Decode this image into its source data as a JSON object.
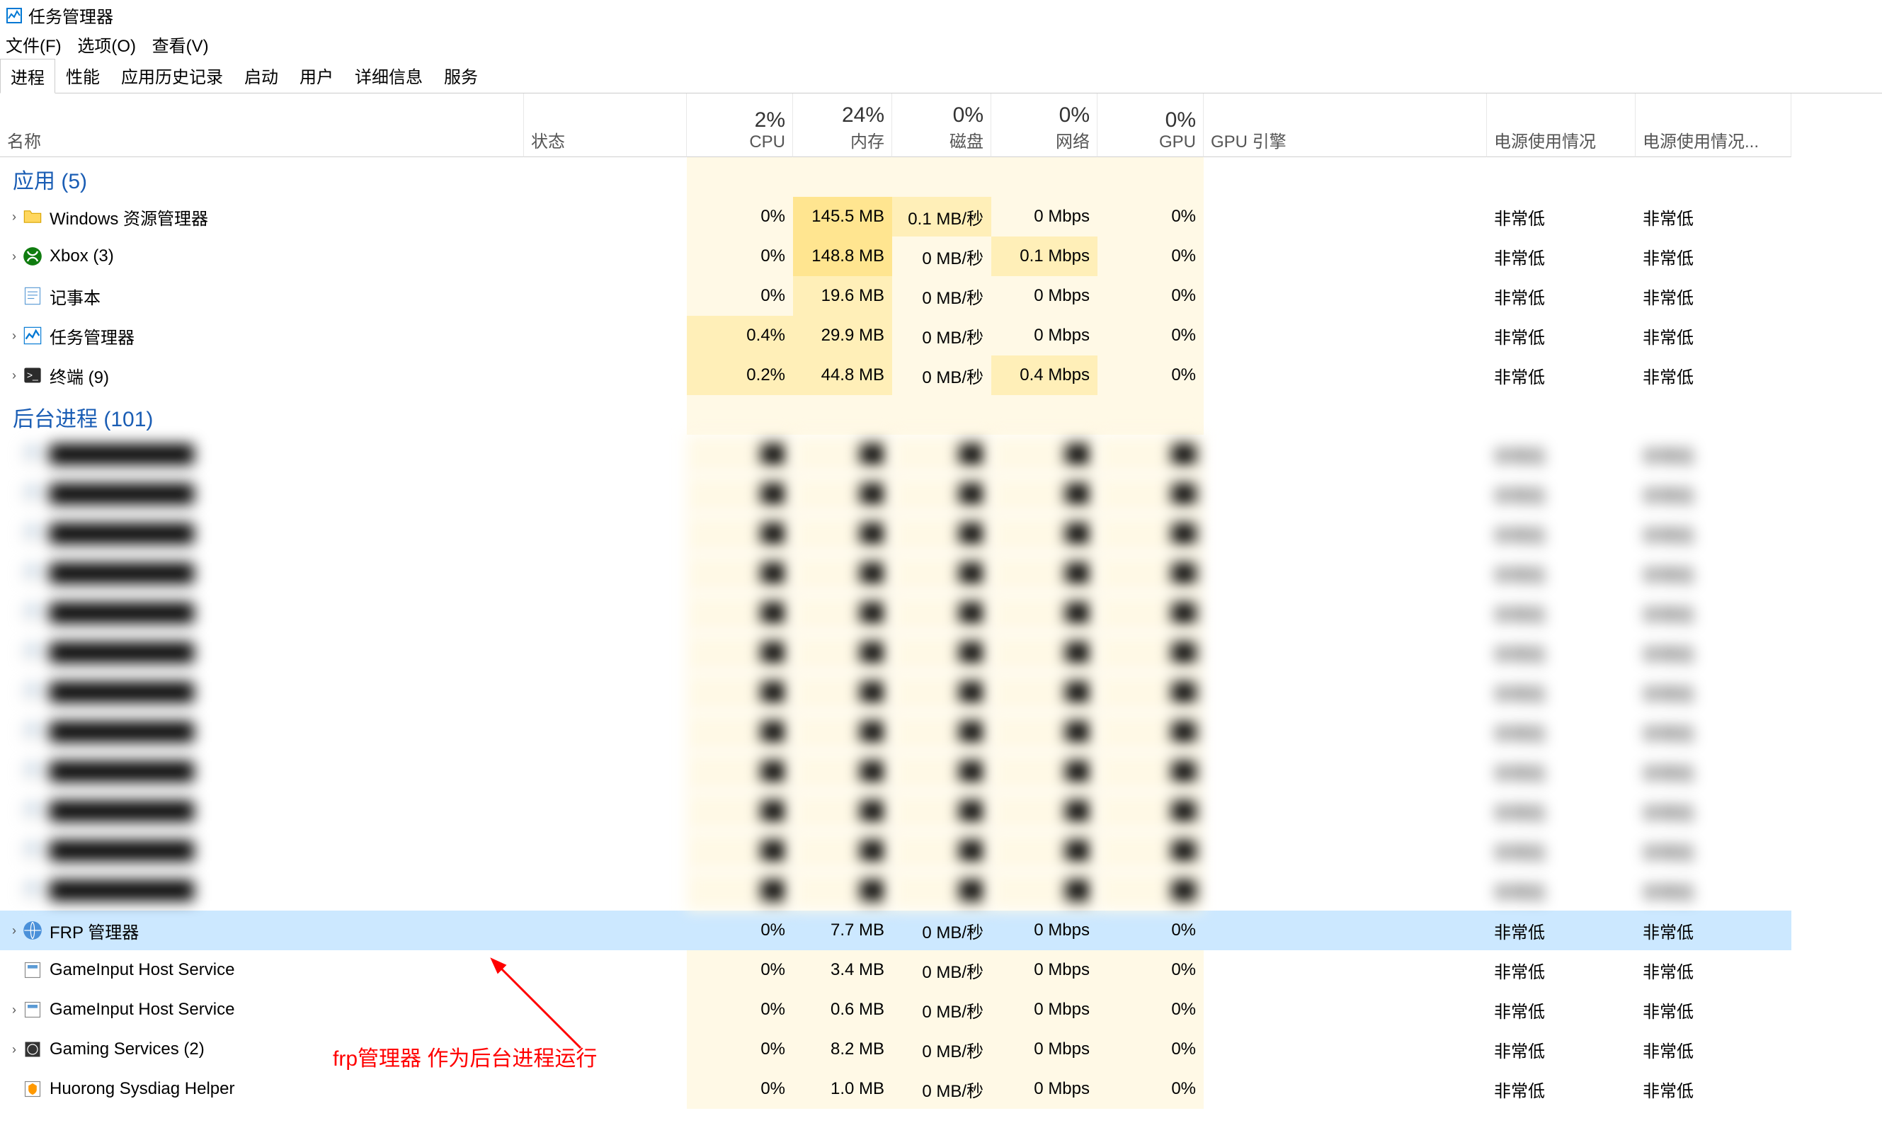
{
  "window": {
    "title": "任务管理器"
  },
  "menu": {
    "file": "文件(F)",
    "options": "选项(O)",
    "view": "查看(V)"
  },
  "tabs": [
    "进程",
    "性能",
    "应用历史记录",
    "启动",
    "用户",
    "详细信息",
    "服务"
  ],
  "activeTab": 0,
  "columns": {
    "name": "名称",
    "status": "状态",
    "cpu": {
      "pct": "2%",
      "label": "CPU"
    },
    "memory": {
      "pct": "24%",
      "label": "内存"
    },
    "disk": {
      "pct": "0%",
      "label": "磁盘"
    },
    "network": {
      "pct": "0%",
      "label": "网络"
    },
    "gpu": {
      "pct": "0%",
      "label": "GPU"
    },
    "gpuengine": "GPU 引擎",
    "power": "电源使用情况",
    "powertrend": "电源使用情况..."
  },
  "groups": {
    "apps": {
      "title": "应用 (5)"
    },
    "background": {
      "title": "后台进程 (101)"
    }
  },
  "apps": [
    {
      "name": "Windows 资源管理器",
      "icon": "folder",
      "exp": true,
      "cpu": "0%",
      "ch": 0,
      "mem": "145.5 MB",
      "mh": 2,
      "disk": "0.1 MB/秒",
      "dh": 1,
      "net": "0 Mbps",
      "nh": 0,
      "gpu": "0%",
      "gh": 0,
      "pow": "非常低",
      "pt": "非常低"
    },
    {
      "name": "Xbox (3)",
      "icon": "xbox",
      "exp": true,
      "cpu": "0%",
      "ch": 0,
      "mem": "148.8 MB",
      "mh": 2,
      "disk": "0 MB/秒",
      "dh": 0,
      "net": "0.1 Mbps",
      "nh": 1,
      "gpu": "0%",
      "gh": 0,
      "pow": "非常低",
      "pt": "非常低"
    },
    {
      "name": "记事本",
      "icon": "notepad",
      "exp": false,
      "cpu": "0%",
      "ch": 0,
      "mem": "19.6 MB",
      "mh": 1,
      "disk": "0 MB/秒",
      "dh": 0,
      "net": "0 Mbps",
      "nh": 0,
      "gpu": "0%",
      "gh": 0,
      "pow": "非常低",
      "pt": "非常低"
    },
    {
      "name": "任务管理器",
      "icon": "taskmgr",
      "exp": true,
      "cpu": "0.4%",
      "ch": 1,
      "mem": "29.9 MB",
      "mh": 1,
      "disk": "0 MB/秒",
      "dh": 0,
      "net": "0 Mbps",
      "nh": 0,
      "gpu": "0%",
      "gh": 0,
      "pow": "非常低",
      "pt": "非常低"
    },
    {
      "name": "终端 (9)",
      "icon": "terminal",
      "exp": true,
      "cpu": "0.2%",
      "ch": 1,
      "mem": "44.8 MB",
      "mh": 1,
      "disk": "0 MB/秒",
      "dh": 0,
      "net": "0.4 Mbps",
      "nh": 1,
      "gpu": "0%",
      "gh": 0,
      "pow": "非常低",
      "pt": "非常低"
    }
  ],
  "background": [
    {
      "blur": true,
      "exp": false,
      "pow": "非常低",
      "pt": "非常低"
    },
    {
      "blur": true,
      "exp": false,
      "pow": "非常低",
      "pt": "非常低"
    },
    {
      "blur": true,
      "exp": false,
      "pow": "非常低",
      "pt": "非常低"
    },
    {
      "blur": true,
      "exp": false,
      "pow": "非常低",
      "pt": "非常低"
    },
    {
      "blur": true,
      "exp": false,
      "pow": "非常低",
      "pt": "非常低"
    },
    {
      "blur": true,
      "exp": false,
      "pow": "非常低",
      "pt": "非常低"
    },
    {
      "blur": true,
      "exp": false,
      "pow": "非常低",
      "pt": "非常低"
    },
    {
      "blur": true,
      "exp": false,
      "pow": "非常低",
      "pt": "非常低"
    },
    {
      "blur": true,
      "exp": false,
      "pow": "非常低",
      "pt": "非常低"
    },
    {
      "blur": true,
      "exp": false,
      "pow": "非常低",
      "pt": "非常低"
    },
    {
      "blur": true,
      "exp": false,
      "pow": "非常低",
      "pt": "非常低"
    },
    {
      "blur": true,
      "exp": false,
      "pow": "非常低",
      "pt": "非常低"
    },
    {
      "name": "FRP 管理器",
      "icon": "frp",
      "exp": true,
      "sel": true,
      "cpu": "0%",
      "ch": 0,
      "mem": "7.7 MB",
      "mh": 0,
      "disk": "0 MB/秒",
      "dh": 0,
      "net": "0 Mbps",
      "nh": 0,
      "gpu": "0%",
      "gh": 0,
      "pow": "非常低",
      "pt": "非常低"
    },
    {
      "name": "GameInput Host Service",
      "icon": "generic",
      "exp": false,
      "cpu": "0%",
      "ch": 0,
      "mem": "3.4 MB",
      "mh": 0,
      "disk": "0 MB/秒",
      "dh": 0,
      "net": "0 Mbps",
      "nh": 0,
      "gpu": "0%",
      "gh": 0,
      "pow": "非常低",
      "pt": "非常低"
    },
    {
      "name": "GameInput Host Service",
      "icon": "generic",
      "exp": true,
      "cpu": "0%",
      "ch": 0,
      "mem": "0.6 MB",
      "mh": 0,
      "disk": "0 MB/秒",
      "dh": 0,
      "net": "0 Mbps",
      "nh": 0,
      "gpu": "0%",
      "gh": 0,
      "pow": "非常低",
      "pt": "非常低"
    },
    {
      "name": "Gaming Services (2)",
      "icon": "gaming",
      "exp": true,
      "cpu": "0%",
      "ch": 0,
      "mem": "8.2 MB",
      "mh": 0,
      "disk": "0 MB/秒",
      "dh": 0,
      "net": "0 Mbps",
      "nh": 0,
      "gpu": "0%",
      "gh": 0,
      "pow": "非常低",
      "pt": "非常低"
    },
    {
      "name": "Huorong Sysdiag Helper",
      "icon": "huorong",
      "exp": false,
      "cpu": "0%",
      "ch": 0,
      "mem": "1.0 MB",
      "mh": 0,
      "disk": "0 MB/秒",
      "dh": 0,
      "net": "0 Mbps",
      "nh": 0,
      "gpu": "0%",
      "gh": 0,
      "pow": "非常低",
      "pt": "非常低"
    }
  ],
  "annotation": {
    "text": "frp管理器 作为后台进程运行"
  }
}
